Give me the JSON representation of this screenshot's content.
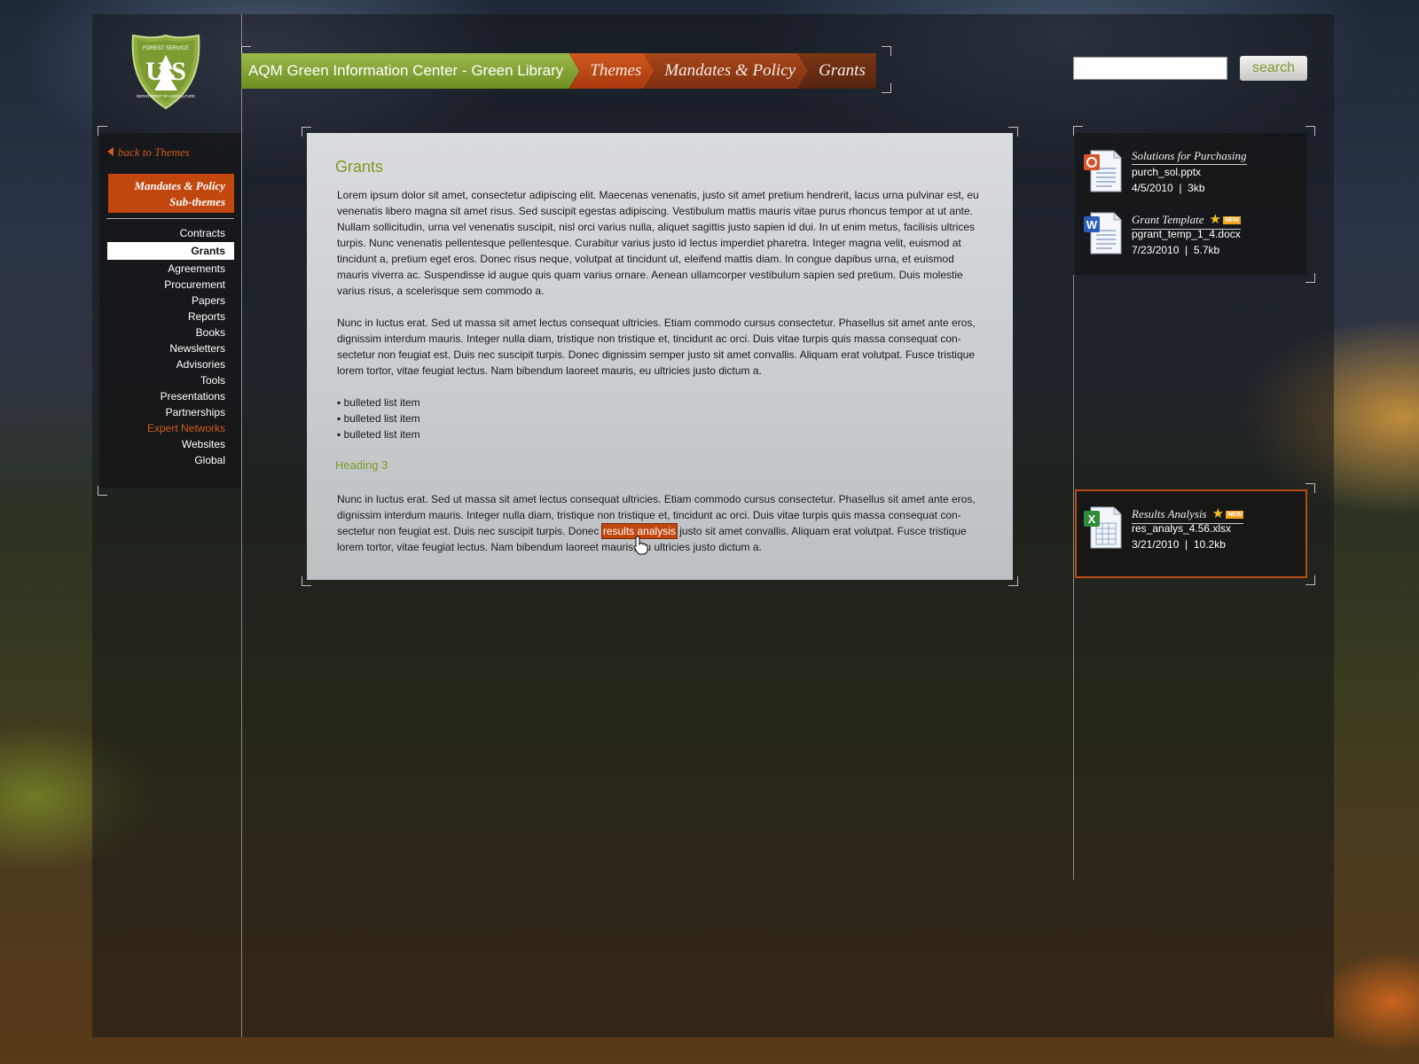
{
  "logo": {
    "top_text": "FOREST SERVICE",
    "middle_text": "U S",
    "bottom_text": "DEPARTMENT OF AGRICULTURE"
  },
  "breadcrumb": {
    "home": "AQM Green Information Center - Green Library",
    "items": [
      "Themes",
      "Mandates & Policy",
      "Grants"
    ]
  },
  "search": {
    "placeholder": "",
    "button_label": "search"
  },
  "sidebar": {
    "back_label": "back to Themes",
    "subtheme_line1": "Mandates & Policy",
    "subtheme_line2": "Sub-themes",
    "items": [
      {
        "label": "Contracts"
      },
      {
        "label": "Grants"
      },
      {
        "label": "Agreements"
      },
      {
        "label": "Procurement"
      },
      {
        "label": "Papers"
      },
      {
        "label": "Reports"
      },
      {
        "label": "Books"
      },
      {
        "label": "Newsletters"
      },
      {
        "label": "Advisories"
      },
      {
        "label": "Tools"
      },
      {
        "label": "Presentations"
      },
      {
        "label": "Partnerships"
      },
      {
        "label": "Expert Networks"
      },
      {
        "label": "Websites"
      },
      {
        "label": "Global"
      }
    ],
    "active_item": "Grants",
    "highlight_item": "Expert Networks"
  },
  "content": {
    "title": "Grants",
    "para1": "Lorem ipsum dolor sit amet, consectetur adipiscing elit. Maecenas venenatis, justo sit amet pretium hendrerit, lacus urna pulvinar est, eu venenatis libero magna sit amet risus. Sed suscipit egestas adipiscing. Vestibulum mattis mauris vitae purus rhoncus tempor at ut ante. Nullam sollicitudin, urna vel venenatis suscipit, nisl orci varius nulla, aliquet sagittis justo sapien id dui. In ut enim metus, facilisis ultrices turpis. Nunc venenatis pellentesque pellentesque. Curabitur varius justo id lectus imperdiet pharetra. Integer magna velit, euismod at tincidunt a, pretium eget eros. Donec risus neque, volutpat at tincidunt ut, eleifend mattis diam. In congue dapibus urna, et euismod mauris viverra ac. Suspendisse id augue quis quam varius ornare. Aenean ullamcorper vestibulum sapien sed pretium. Duis molestie varius risus, a scelerisque sem commodo a.",
    "para2": "Nunc in luctus erat. Sed ut massa sit amet lectus consequat ultricies. Etiam commodo cursus consectetur. Phasellus sit amet ante eros, dignissim interdum mauris. Integer nulla diam, tristique non tristique et, tincidunt ac orci. Duis vitae turpis quis massa consequat con-sectetur non feugiat est. Duis nec suscipit turpis. Donec dignissim semper justo sit amet convallis. Aliquam erat volutpat. Fusce tristique lorem tortor, vitae feugiat lectus. Nam bibendum laoreet mauris, eu ultricies justo dictum a.",
    "bullets": [
      "bulleted list item",
      "bulleted list item",
      "bulleted list item"
    ],
    "heading3": "Heading 3",
    "para3_before": "Nunc in luctus erat. Sed ut massa sit amet lectus consequat ultricies. Etiam commodo cursus consectetur. Phasellus sit amet ante eros, dignissim interdum mauris. Integer nulla diam, tristique non tristique et, tincidunt ac orci. Duis vitae turpis quis massa consequat con-sectetur non feugiat est. Duis nec suscipit turpis. Donec ",
    "para3_link": "results analysis",
    "para3_after": " justo sit amet convallis. Aliquam erat volutpat. Fusce tristique lorem tortor, vitae feugiat lectus. Nam bibendum laoreet mauris, eu ultricies justo dictum a."
  },
  "files": [
    {
      "title": "Solutions for Purchasing",
      "filename": "purch_sol.pptx",
      "date": "4/5/2010",
      "size": "3kb",
      "icon": "powerpoint-icon",
      "is_new": false
    },
    {
      "title": "Grant Template",
      "filename": "pgrant_temp_1_4.docx",
      "date": "7/23/2010",
      "size": "5.7kb",
      "icon": "word-icon",
      "is_new": true,
      "badge": "NEW"
    },
    {
      "title": "Results Analysis",
      "filename": "res_analys_4.56.xlsx",
      "date": "3/21/2010",
      "size": "10.2kb",
      "icon": "excel-icon",
      "is_new": true,
      "badge": "NEW"
    }
  ],
  "colors": {
    "accent_orange": "#c1470f",
    "accent_green": "#7a9a24",
    "crumb_green": "#8aa83a"
  }
}
